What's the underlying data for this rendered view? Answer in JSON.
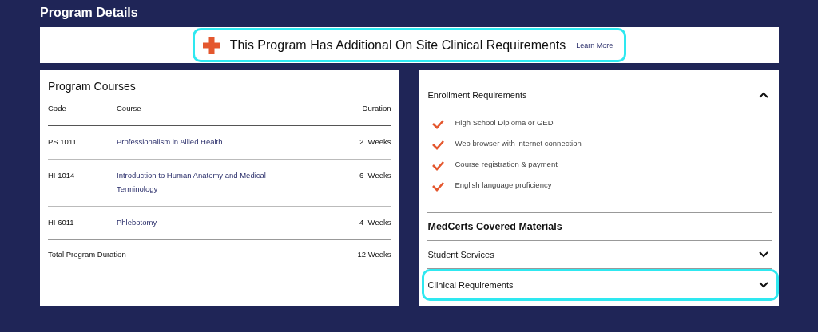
{
  "page_title": "Program Details",
  "banner": {
    "text": "This Program Has Additional On Site Clinical Requirements",
    "link": "Learn More",
    "highlighted": true
  },
  "courses": {
    "title": "Program Courses",
    "columns": [
      "Code",
      "Course",
      "Duration"
    ],
    "rows": [
      {
        "code": "PS 1011",
        "course": "Professionalism in Allied Health",
        "duration": "2  Weeks"
      },
      {
        "code": "HI 1014",
        "course": "Introduction to Human Anatomy and Medical Terminology",
        "duration": "6  Weeks"
      },
      {
        "code": "HI 6011",
        "course": "Phlebotomy",
        "duration": "4  Weeks"
      }
    ],
    "total": {
      "label": "Total Program Duration",
      "value": "12 Weeks"
    }
  },
  "sections": [
    {
      "kind": "accordion",
      "title": "Enrollment Requirements",
      "expanded": true,
      "highlighted": false,
      "items": [
        "High School Diploma or GED",
        "Web browser with internet connection",
        "Course registration & payment",
        "English language proficiency"
      ]
    },
    {
      "kind": "plain",
      "title": "MedCerts Covered Materials",
      "highlighted": false
    },
    {
      "kind": "accordion",
      "title": "Student Services",
      "expanded": false,
      "highlighted": false
    },
    {
      "kind": "accordion",
      "title": "Clinical Requirements",
      "expanded": false,
      "highlighted": true
    }
  ]
}
